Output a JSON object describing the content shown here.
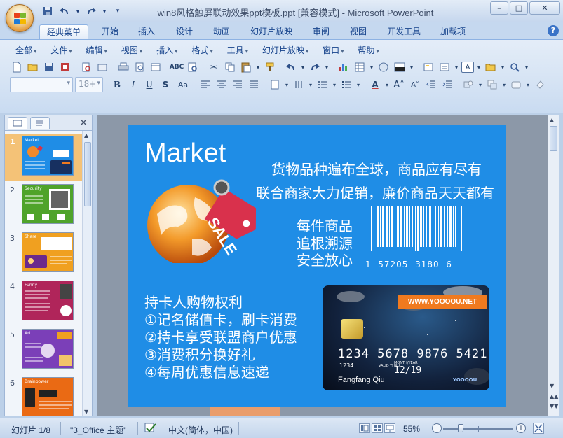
{
  "window": {
    "title": "win8风格触屏联动效果ppt模板.ppt [兼容模式] - Microsoft PowerPoint",
    "controls": [
      "–",
      "□",
      "✕"
    ]
  },
  "quick_access": [
    "save-icon",
    "undo-icon",
    "redo-icon",
    "customize-icon"
  ],
  "ribbon_tabs": [
    "经典菜单",
    "开始",
    "插入",
    "设计",
    "动画",
    "幻灯片放映",
    "审阅",
    "视图",
    "开发工具",
    "加载项"
  ],
  "classic_menu": [
    "全部",
    "文件",
    "编辑",
    "视图",
    "插入",
    "格式",
    "工具",
    "幻灯片放映",
    "窗口",
    "帮助"
  ],
  "font": {
    "size": "18+"
  },
  "slides": [
    {
      "num": "1",
      "title": "Market",
      "bg": "#1f8de6"
    },
    {
      "num": "2",
      "title": "Security",
      "bg": "#4fa32a"
    },
    {
      "num": "3",
      "title": "Share",
      "bg": "#f0a020"
    },
    {
      "num": "4",
      "title": "Funny",
      "bg": "#b0255a"
    },
    {
      "num": "5",
      "title": "Art",
      "bg": "#7b3fb8"
    },
    {
      "num": "6",
      "title": "Brainpower",
      "bg": "#ea6a14"
    }
  ],
  "slide": {
    "title": "Market",
    "line1": "货物品种遍布全球，商品应有尽有",
    "line2": "联合商家大力促销，廉价商品天天都有",
    "trace1": "每件商品",
    "trace2": "追根溯源",
    "trace3": "安全放心",
    "barcode_number": "1  57205  3180  6",
    "sale_tag": "SALE",
    "rights_title": "持卡人购物权利",
    "right1": "①记名储值卡，刷卡消费",
    "right2": "②持卡享受联盟商户优惠",
    "right3": "③消费积分换好礼",
    "right4": "④每周优惠信息速递",
    "card": {
      "url": "WWW.YOOOOU.NET",
      "number": "1234 5678 9876 5421",
      "sub": "1234",
      "valid_label": "VALID THRU",
      "month_year": "MONTH/YEAR",
      "expiry": "12/19",
      "holder": "Fangfang Qiu",
      "brand": "YOOOOU"
    }
  },
  "status": {
    "slide_pos": "幻灯片 1/8",
    "theme": "\"3_Office 主题\"",
    "language": "中文(简体，中国)",
    "zoom": "55%",
    "zoom_level": 0.55
  },
  "colors": {
    "slide_bg": "#1f8de6",
    "accent_orange": "#f07a1f",
    "selected_thumb": "#f4c277"
  }
}
